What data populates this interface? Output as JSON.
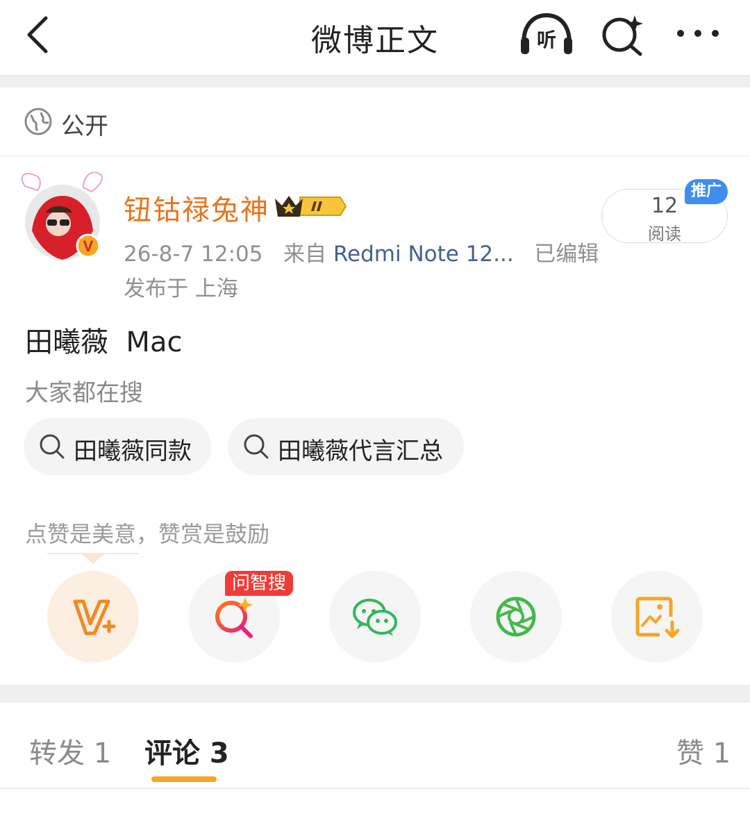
{
  "header": {
    "title": "微博正文",
    "listen_label": "听",
    "icons": [
      "back-icon",
      "headphones-icon",
      "ai-search-icon",
      "more-icon"
    ]
  },
  "visibility": {
    "label": "公开",
    "icon": "globe-icon"
  },
  "post": {
    "author": "钮钴禄兔神",
    "time": "26-8-7 12:05",
    "source_prefix": "来自",
    "source": "Redmi Note 12...",
    "edited": "已编辑",
    "location": "发布于 上海",
    "read_count": "12",
    "read_label": "阅读",
    "promo_tag": "推广",
    "text": "田曦薇  Mac",
    "verified_badge": "V"
  },
  "search": {
    "heading": "大家都在搜",
    "chips": [
      "田曦薇同款",
      "田曦薇代言汇总"
    ]
  },
  "appreciate": {
    "text": "点赞是美意，赞赏是鼓励",
    "ai_tag": "问智搜",
    "actions": [
      "v-plus-icon",
      "ai-search-icon",
      "wechat-icon",
      "moments-icon",
      "save-image-icon"
    ]
  },
  "tabs": {
    "repost": "转发 1",
    "comment": "评论 3",
    "like": "赞 1"
  },
  "colors": {
    "author": "#e8741c",
    "source_link": "#44608f",
    "tab_underline": "#f5a623",
    "promo_tag": "#3e8ef0",
    "ai_tag": "#f03c36"
  }
}
